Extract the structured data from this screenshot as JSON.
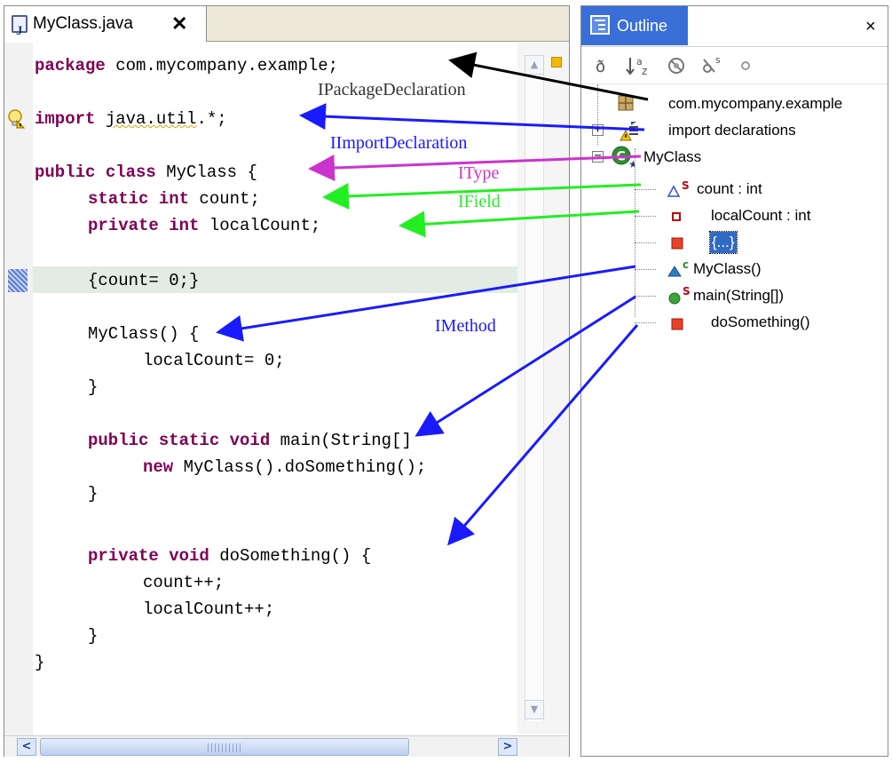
{
  "colors": {
    "keyword": "#7f0055",
    "arrow_package": "#000000",
    "arrow_import": "#1a1aff",
    "arrow_type": "#cc33cc",
    "arrow_field": "#22ee22",
    "arrow_method": "#1a1aff",
    "outline_tab_active": "#3a6fd8",
    "selection": "#316ac5"
  },
  "editor": {
    "tab_label": "MyClass.java",
    "close_glyph": "✕",
    "code": {
      "line1_kw": "package",
      "line1_rest": " com.mycompany.example;",
      "line2_kw": "import",
      "line2_space": " ",
      "line2_pkg": "java.util",
      "line2_rest": ".*;",
      "line3_kw": "public class",
      "line3_rest": " MyClass {",
      "line4_kw": "static int",
      "line4_rest": " count;",
      "line5_kw": "private int",
      "line5_rest": " localCount;",
      "line6": "{count= 0;}",
      "line7": "MyClass() {",
      "line8": "localCount= 0;",
      "line9": "}",
      "line10_kw": "public static void",
      "line10_rest": " main(String[]",
      "line11_kw": "new",
      "line11_rest": " MyClass().doSomething();",
      "line12": "}",
      "line13_kw": "private void",
      "line13_rest": " doSomething() {",
      "line14": "count++;",
      "line15": "localCount++;",
      "line16": "}",
      "line17": "}"
    },
    "hscroll_grip": "III",
    "scroll_up_glyph": "▲",
    "scroll_down_glyph": "▼",
    "scroll_left_glyph": "<",
    "scroll_right_glyph": ">"
  },
  "outline": {
    "title": "Outline",
    "close_glyph": "×",
    "toolbar": {
      "hide_fields_icon": "hide-fields-icon",
      "sort_icon": "sort-alphabetically-icon",
      "hide_non_public_icon": "hide-non-public-icon",
      "hide_static_icon": "hide-static-icon",
      "hide_local_types_icon": "hide-local-types-icon",
      "sort_label": "↓ᵃz",
      "static_label": "s"
    },
    "items": [
      {
        "label": "com.mycompany.example",
        "icon": "package-icon"
      },
      {
        "label": "import declarations",
        "icon": "import-container-icon",
        "expander": "+"
      },
      {
        "label": "MyClass",
        "icon": "class-icon",
        "expander": "−",
        "icon_letter": "C"
      },
      {
        "label": "count : int",
        "icon": "package-field-icon",
        "badge": "S"
      },
      {
        "label": "localCount : int",
        "icon": "private-field-icon"
      },
      {
        "label": "{...}",
        "icon": "private-initializer-icon"
      },
      {
        "label": "MyClass()",
        "icon": "constructor-icon",
        "badge": "c"
      },
      {
        "label": "main(String[])",
        "icon": "public-method-icon",
        "badge": "S"
      },
      {
        "label": "doSomething()",
        "icon": "private-method-icon"
      }
    ]
  },
  "annotations": {
    "package": "IPackageDeclaration",
    "import": "IImportDeclaration",
    "type": "IType",
    "field": "IField",
    "method": "IMethod"
  }
}
